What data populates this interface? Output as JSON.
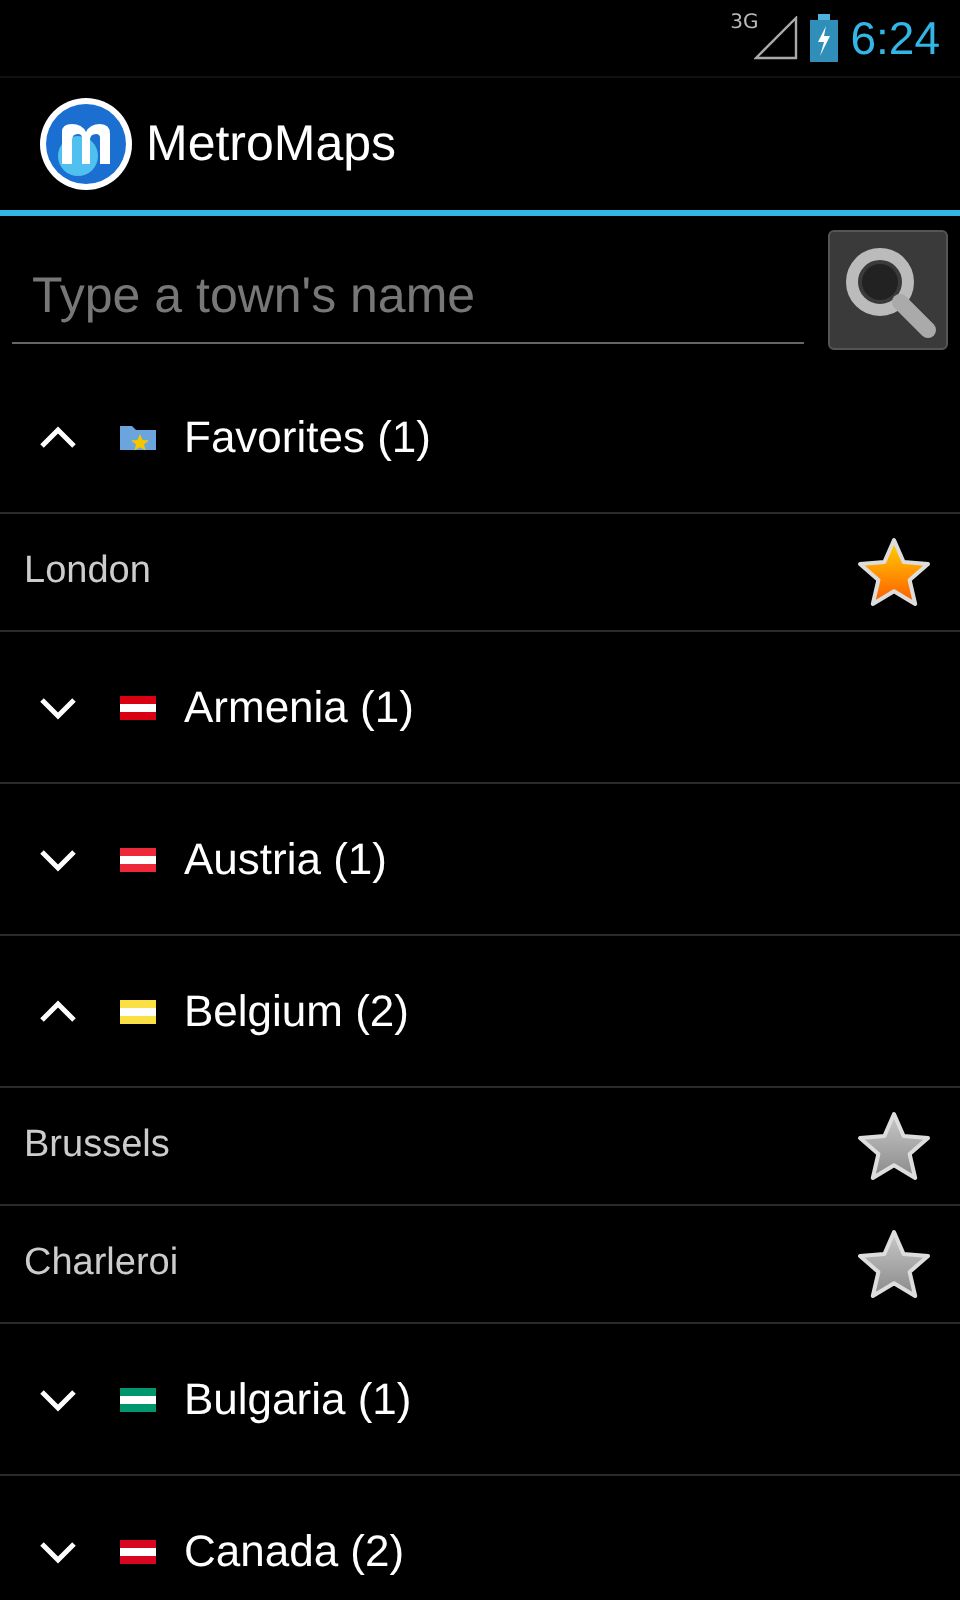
{
  "status_bar": {
    "network": "3G",
    "time": "6:24"
  },
  "app_bar": {
    "title": "MetroMaps"
  },
  "search": {
    "placeholder": "Type a town's name"
  },
  "groups": [
    {
      "label": "Favorites (1)",
      "kind": "favorites",
      "expanded": true,
      "cities": [
        {
          "name": "London",
          "favorite": true
        }
      ]
    },
    {
      "label": "Armenia (1)",
      "kind": "flag",
      "color": "#d90012",
      "expanded": false
    },
    {
      "label": "Austria (1)",
      "kind": "flag",
      "color": "#ed2939",
      "expanded": false
    },
    {
      "label": "Belgium (2)",
      "kind": "flag",
      "color": "#fae042",
      "expanded": true,
      "cities": [
        {
          "name": "Brussels",
          "favorite": false
        },
        {
          "name": "Charleroi",
          "favorite": false
        }
      ]
    },
    {
      "label": "Bulgaria (1)",
      "kind": "flag",
      "color": "#00966e",
      "expanded": false
    },
    {
      "label": "Canada (2)",
      "kind": "flag",
      "color": "#d80621",
      "expanded": false
    }
  ]
}
